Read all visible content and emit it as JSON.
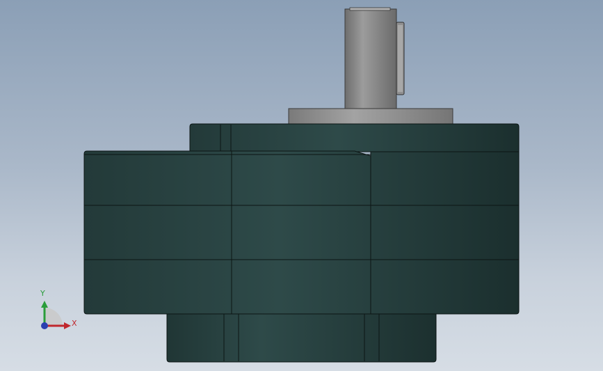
{
  "triad": {
    "x_label": "X",
    "y_label": "Y",
    "x_color": "#c0272d",
    "y_color": "#2a9d3a",
    "z_color": "#2a3fb0"
  },
  "model": {
    "housing_color": "#27403f",
    "edge_color": "#0c1514",
    "shaft_color": "#8a8a8a"
  }
}
